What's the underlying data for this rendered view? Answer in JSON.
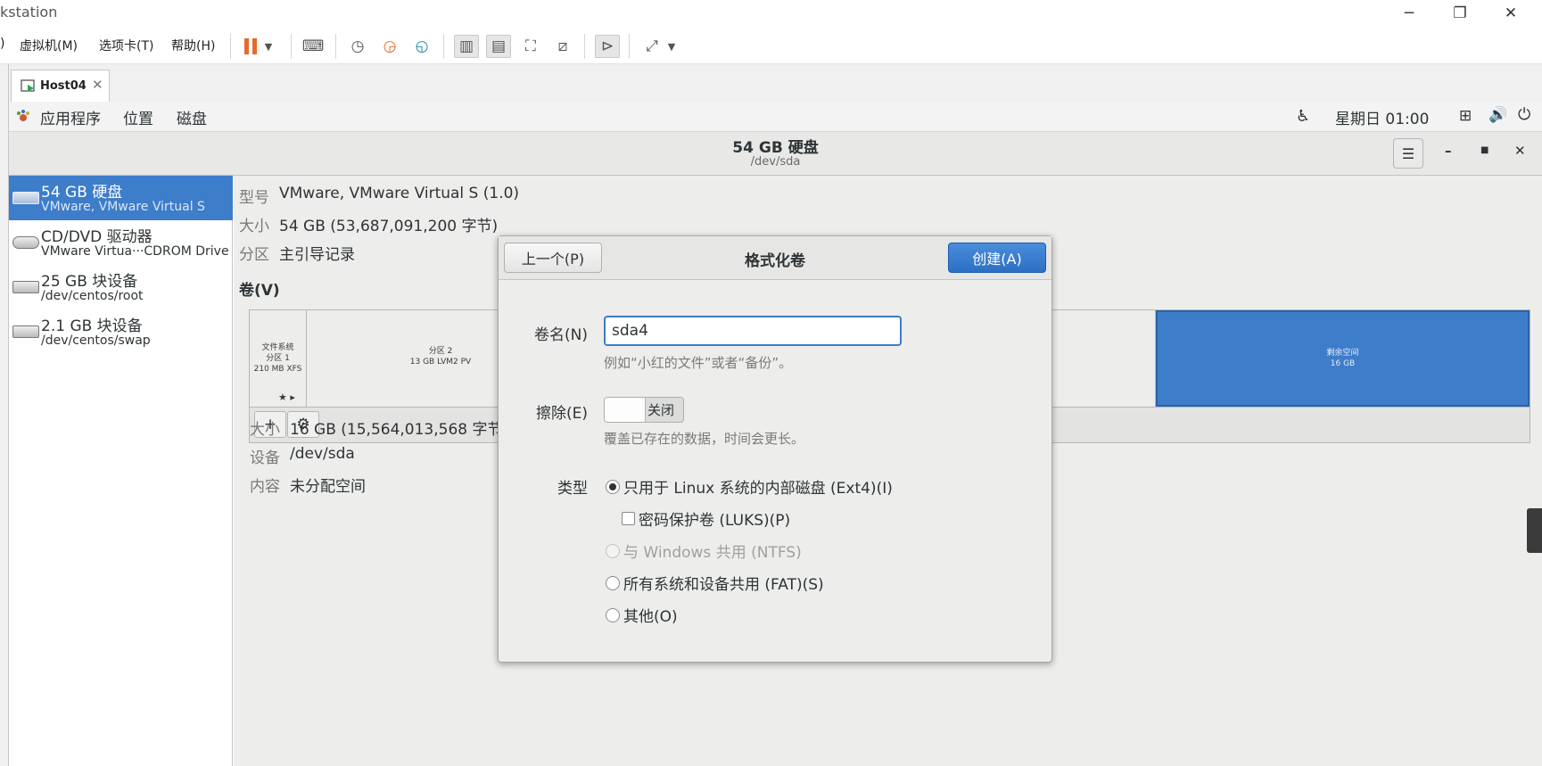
{
  "app": {
    "title": "kstation"
  },
  "vm_menu": [
    {
      "label": ")"
    },
    {
      "label": "虚拟机(M)"
    },
    {
      "label": "选项卡(T)"
    },
    {
      "label": "帮助(H)"
    }
  ],
  "vm_tab": {
    "label": "Host04"
  },
  "colors": {
    "accent": "#3d7dca",
    "pause": "#e8692b"
  },
  "gnome": {
    "menus": [
      "应用程序",
      "位置",
      "磁盘"
    ],
    "clock": "星期日 01:00"
  },
  "disks": {
    "title": "54 GB 硬盘",
    "subtitle": "/dev/sda",
    "devices": [
      {
        "name": "54 GB 硬盘",
        "detail": "VMware, VMware Virtual S",
        "selected": true
      },
      {
        "name": "CD/DVD 驱动器",
        "detail": "VMware Virtua···CDROM Drive"
      },
      {
        "name": "25 GB 块设备",
        "detail": "/dev/centos/root"
      },
      {
        "name": "2.1 GB 块设备",
        "detail": "/dev/centos/swap"
      }
    ],
    "info": {
      "model_label": "型号",
      "model": "VMware, VMware Virtual S (1.0)",
      "size_label": "大小",
      "size": "54 GB (53,687,091,200 字节)",
      "partitioning_label": "分区",
      "partitioning": "主引导记录"
    },
    "volumes_label": "卷(V)",
    "segments": [
      {
        "line1": "文件系统",
        "line2": "分区 1",
        "line3": "210 MB XFS"
      },
      {
        "line1": "分区 2",
        "line2": "13 GB LVM2 PV"
      },
      {
        "line1": "剩余空间",
        "line2": "16 GB"
      }
    ],
    "segment_marks": "★ ▸",
    "selected": {
      "size_label": "大小",
      "size": "16 GB (15,564,013,568 字节",
      "device_label": "设备",
      "device": "/dev/sda",
      "content_label": "内容",
      "content": "未分配空间"
    }
  },
  "dialog": {
    "title": "格式化卷",
    "prev_label": "上一个(P)",
    "create_label": "创建(A)",
    "name_label": "卷名(N)",
    "name_value": "sda4",
    "name_hint": "例如“小红的文件”或者“备份”。",
    "erase_label": "擦除(E)",
    "erase_state": "关闭",
    "erase_hint": "覆盖已存在的数据，时间会更长。",
    "type_label": "类型",
    "types": [
      {
        "label": "只用于 Linux 系统的内部磁盘 (Ext4)(I)",
        "selected": true
      },
      {
        "label": "密码保护卷 (LUKS)(P)"
      },
      {
        "label": "与 Windows 共用 (NTFS)",
        "disabled": true
      },
      {
        "label": "所有系统和设备共用 (FAT)(S)"
      },
      {
        "label": "其他(O)"
      }
    ]
  }
}
